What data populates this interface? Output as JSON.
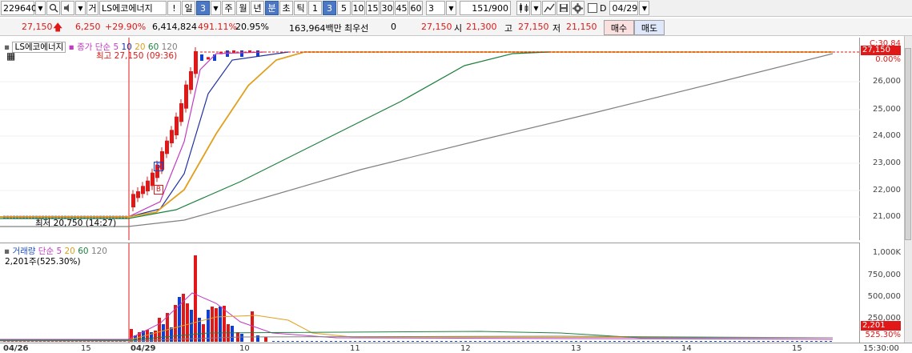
{
  "toolbar": {
    "code": "229640",
    "type_label": "거",
    "stock_name": "LS에코에너지",
    "btn_excl": "!",
    "btn_day": "일",
    "btn_day_num": "3",
    "btn_week": "주",
    "btn_month": "월",
    "btn_year": "년",
    "btn_min": "분",
    "btn_sec": "초",
    "btn_tick": "틱",
    "intervals": [
      "1",
      "3",
      "5",
      "10",
      "15",
      "30",
      "45",
      "60"
    ],
    "interval_value": "3",
    "count": "151",
    "count_total": "/900",
    "d_label": "D",
    "date": "04/29"
  },
  "quote": {
    "price": "27,150",
    "change": "6,250",
    "change_pct": "+29.90%",
    "volume": "6,414,824",
    "vol_ratio": "491.11%",
    "turnover": "20.95%",
    "amount": "163,964백만",
    "priority_label": "최우선",
    "priority_val": "0",
    "ask": "27,150",
    "open_label": "시",
    "open": "21,300",
    "high_label": "고",
    "high": "27,150",
    "low_label": "저",
    "low": "21,150",
    "buy": "매수",
    "sell": "매도"
  },
  "price_pane": {
    "stock_tag": "LS에코에너지",
    "legend": [
      {
        "text": "종가 단순",
        "color": "#c03cc0"
      },
      {
        "text": "5",
        "color": "#c03cc0"
      },
      {
        "text": "10",
        "color": "#2030a0"
      },
      {
        "text": "20",
        "color": "#e0a020"
      },
      {
        "text": "60",
        "color": "#208040"
      },
      {
        "text": "120",
        "color": "#808080"
      }
    ],
    "high_note": "최고 27,150 (09:36)",
    "low_note": "최저 20,750 (14:27)",
    "sell_marker": "S",
    "buy_marker": "B",
    "axis_top_label": "C:30.84",
    "axis_price_tag": "27,150",
    "axis_pct_tag": "0.00%",
    "yticks": [
      "26,000",
      "25,000",
      "24,000",
      "23,000",
      "22,000",
      "21,000"
    ]
  },
  "vol_pane": {
    "legend": [
      {
        "text": "거래량",
        "color": "#2050c0"
      },
      {
        "text": "단순",
        "color": "#c03cc0"
      },
      {
        "text": "5",
        "color": "#c03cc0"
      },
      {
        "text": "20",
        "color": "#e0a020"
      },
      {
        "text": "60",
        "color": "#208040"
      },
      {
        "text": "120",
        "color": "#808080"
      }
    ],
    "info": "2,201주(525.30%)",
    "yticks": [
      "1,000K",
      "750,000",
      "500,000",
      "250,000"
    ],
    "axis_tag": "2,201",
    "axis_pct_tag": "525.30%"
  },
  "xaxis": {
    "labels": [
      "04/26",
      "15",
      "04/29",
      "10",
      "11",
      "12",
      "13",
      "14",
      "15"
    ],
    "right_label": "15:30:00"
  },
  "colors": {
    "up": "#e01818",
    "down": "#1040d0",
    "ma5": "#c03cc0",
    "ma10": "#2030a0",
    "ma20": "#e0a020",
    "ma60": "#208040",
    "ma120": "#808080"
  }
}
